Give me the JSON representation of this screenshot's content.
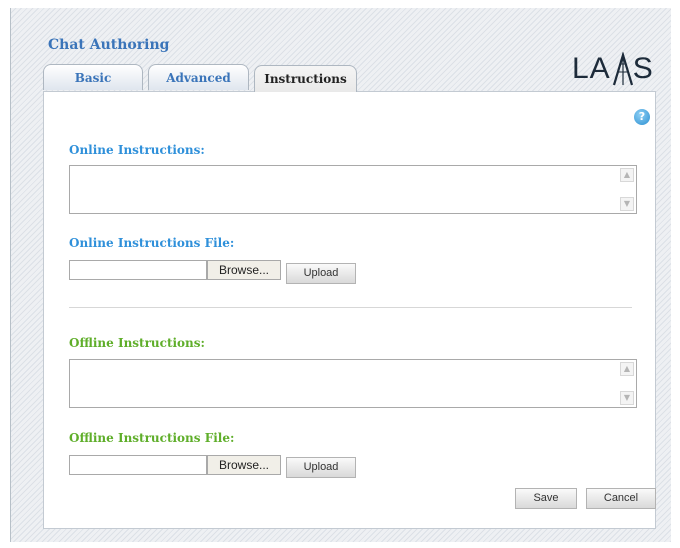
{
  "app": {
    "title": "Chat Authoring",
    "logo_text": "LAMS"
  },
  "tabs": [
    {
      "label": "Basic",
      "active": false
    },
    {
      "label": "Advanced",
      "active": false
    },
    {
      "label": "Instructions",
      "active": true
    }
  ],
  "help": {
    "glyph": "?"
  },
  "online": {
    "label": "Online Instructions:",
    "value": "",
    "file_label": "Online Instructions File:",
    "file_value": "",
    "browse_label": "Browse...",
    "upload_label": "Upload"
  },
  "offline": {
    "label": "Offline Instructions:",
    "value": "",
    "file_label": "Offline Instructions File:",
    "file_value": "",
    "browse_label": "Browse...",
    "upload_label": "Upload"
  },
  "actions": {
    "save_label": "Save",
    "cancel_label": "Cancel"
  },
  "colors": {
    "title": "#3a74b9",
    "online_label": "#2f90da",
    "offline_label": "#5fae2a",
    "help": "#2b8fd1"
  }
}
